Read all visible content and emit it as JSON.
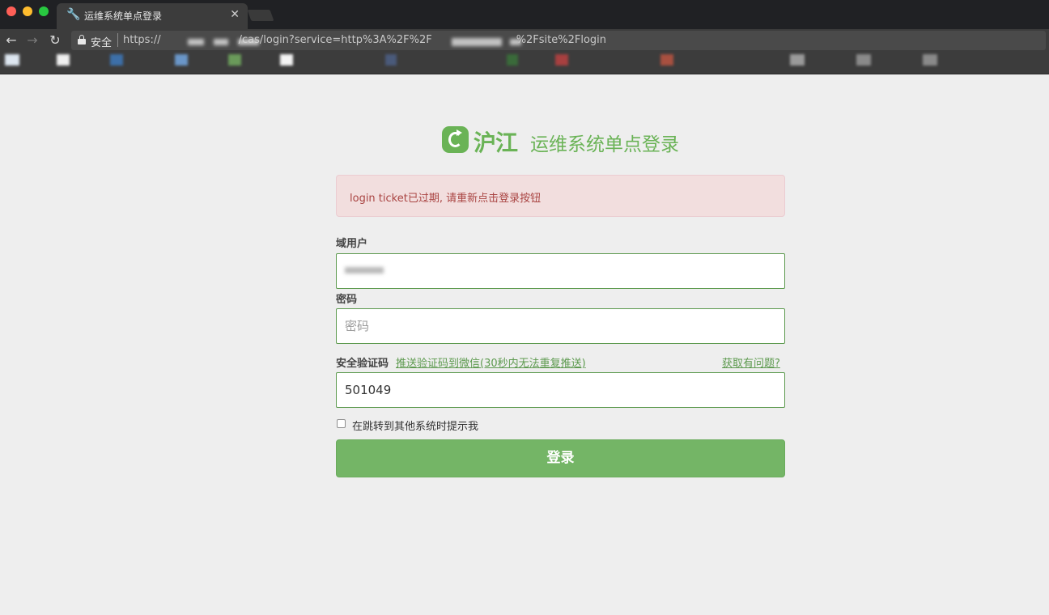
{
  "browser": {
    "tab_title": "运维系统单点登录",
    "tab_icon": "wrench-icon",
    "secure_label": "安全",
    "url_start": "https://",
    "url_middle": "/cas/login?service=http%3A%2F%2F",
    "url_end": "%2Fsite%2Flogin"
  },
  "brand": {
    "logo_text": "沪江",
    "title": "运维系统单点登录",
    "color": "#6ab356"
  },
  "alert": {
    "message": "login ticket已过期, 请重新点击登录按钮"
  },
  "form": {
    "username_label": "域用户",
    "password_label": "密码",
    "password_placeholder": "密码",
    "code_label": "安全验证码",
    "push_code_link": "推送验证码到微信(30秒内无法重复推送)",
    "help_link": "获取有问题?",
    "code_value": "501049",
    "remember_label": "在跳转到其他系统时提示我",
    "submit_label": "登录"
  }
}
